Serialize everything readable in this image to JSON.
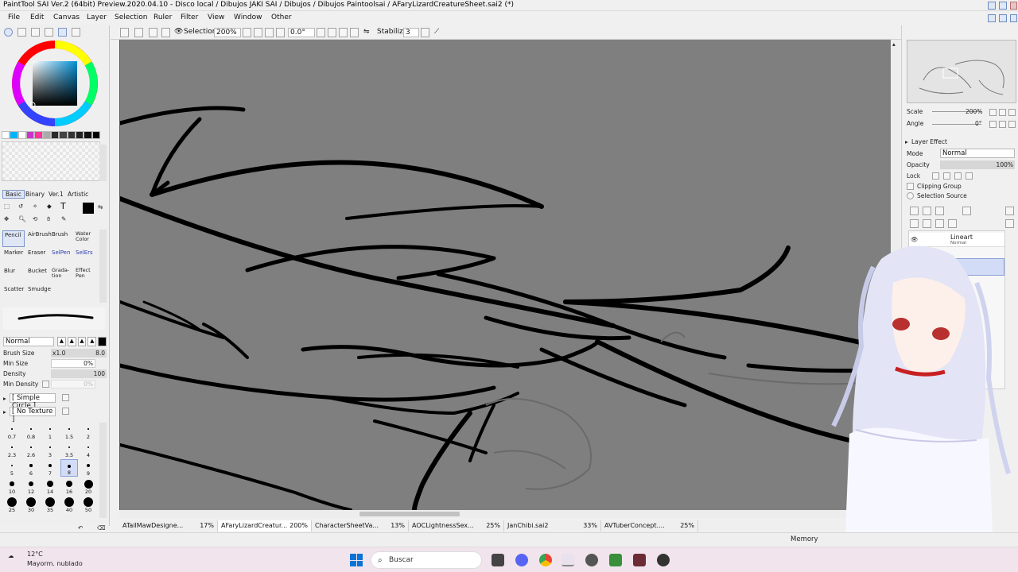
{
  "title_bar": {
    "title": "PaintTool SAI Ver.2 (64bit) Preview.2020.04.10 - Disco local / Dibujos JAKI SAI / Dibujos / Dibujos Paintoolsai / AFaryLizardCreatureSheet.sai2 (*)"
  },
  "menu": [
    "File",
    "Edit",
    "Canvas",
    "Layer",
    "Selection",
    "Ruler",
    "Filter",
    "View",
    "Window",
    "Other"
  ],
  "toolbar": {
    "selection_label": "Selection",
    "zoom": "200%",
    "angle": "0.0°",
    "stabilizer_label": "Stabilizer",
    "stabilizer_value": "3"
  },
  "tool_tabs": [
    "Basic",
    "Binary",
    "Ver.1",
    "Artistic"
  ],
  "tools": [
    {
      "label": "Pencil"
    },
    {
      "label": "AirBrush"
    },
    {
      "label": "Brush"
    },
    {
      "label": "Water Color"
    },
    {
      "label": "Marker"
    },
    {
      "label": "Eraser"
    },
    {
      "label": "SelPen"
    },
    {
      "label": "SelErs"
    },
    {
      "label": "Blur"
    },
    {
      "label": "Bucket"
    },
    {
      "label": "Grada-tion"
    },
    {
      "label": "Effect Pen"
    },
    {
      "label": "Scatter"
    },
    {
      "label": "Smudge"
    }
  ],
  "brush": {
    "blend_mode": "Normal",
    "size_label": "Brush Size",
    "size_mult": "x1.0",
    "size_value": "8.0",
    "min_size_label": "Min Size",
    "min_size_value": "0%",
    "density_label": "Density",
    "density_value": "100",
    "min_density_label": "Min Density",
    "min_density_value": "0%",
    "shape": "[ Simple Circle ]",
    "texture": "[ No Texture ]"
  },
  "brush_sizes": [
    "0.7",
    "0.8",
    "1",
    "1.5",
    "2",
    "2.3",
    "2.6",
    "3",
    "3.5",
    "4",
    "5",
    "6",
    "7",
    "8",
    "9",
    "10",
    "12",
    "14",
    "16",
    "20",
    "25",
    "30",
    "35",
    "40",
    "50"
  ],
  "navigator": {
    "scale_label": "Scale",
    "scale_value": "200%",
    "angle_label": "Angle",
    "angle_value": "0°"
  },
  "layer_panel": {
    "effect_label": "Layer Effect",
    "mode_label": "Mode",
    "mode_value": "Normal",
    "opacity_label": "Opacity",
    "opacity_value": "100%",
    "lock_label": "Lock",
    "clipping_label": "Clipping Group",
    "selection_source_label": "Selection Source",
    "layers": [
      {
        "name": "Lineart",
        "mode": "Normal"
      }
    ]
  },
  "doc_tabs": [
    {
      "name": "ATailMawDesigne...",
      "zoom": "17%"
    },
    {
      "name": "AFaryLizardCreatur...",
      "zoom": "200%"
    },
    {
      "name": "CharacterSheetVa...",
      "zoom": "13%"
    },
    {
      "name": "AOCLightnessSex...",
      "zoom": "25%"
    },
    {
      "name": "JanChibi.sai2",
      "zoom": "33%"
    },
    {
      "name": "AVTuberConcept....",
      "zoom": "25%"
    }
  ],
  "status": {
    "memory_label": "Memory"
  },
  "taskbar": {
    "weather_temp": "12°C",
    "weather_desc": "Mayorm. nublado",
    "search_placeholder": "Buscar"
  },
  "palette_colors": [
    "#ffffff",
    "#00b4ff",
    "#ffffff",
    "#cc33cc",
    "#ff3399",
    "#aaaaaa",
    "#2a2a2a",
    "#444444",
    "#333333",
    "#222222",
    "#111111",
    "#000000"
  ],
  "colors": {
    "canvas_bg": "#7f7f7f",
    "accent": "#3b6fd1",
    "taskbar_bg": "#f1e4ec"
  }
}
